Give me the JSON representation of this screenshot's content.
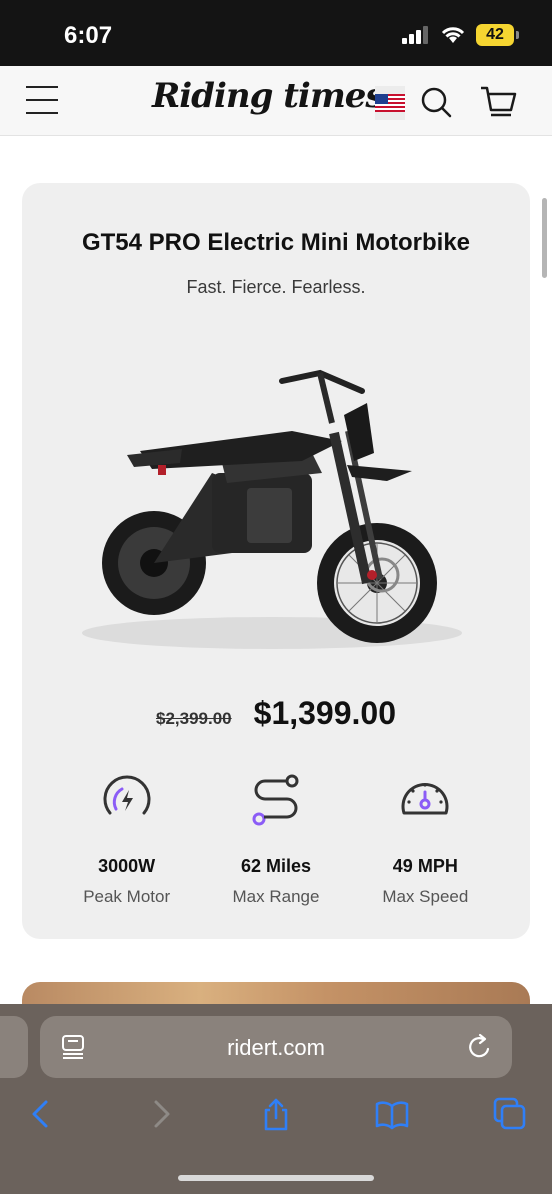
{
  "status": {
    "time": "6:07",
    "battery": "42"
  },
  "header": {
    "logo": "Riding times"
  },
  "product": {
    "title": "GT54 PRO Electric Mini Motorbike",
    "tagline": "Fast. Fierce. Fearless.",
    "old_price": "$2,399.00",
    "price": "$1,399.00",
    "specs": [
      {
        "icon": "motor-icon",
        "value": "3000W",
        "label": "Peak Motor"
      },
      {
        "icon": "route-icon",
        "value": "62 Miles",
        "label": "Max Range"
      },
      {
        "icon": "speedometer-icon",
        "value": "49 MPH",
        "label": "Max Speed"
      }
    ]
  },
  "browser": {
    "url": "ridert.com"
  },
  "colors": {
    "accent": "#8b5cf6",
    "safari_blue": "#2f7ff7"
  }
}
